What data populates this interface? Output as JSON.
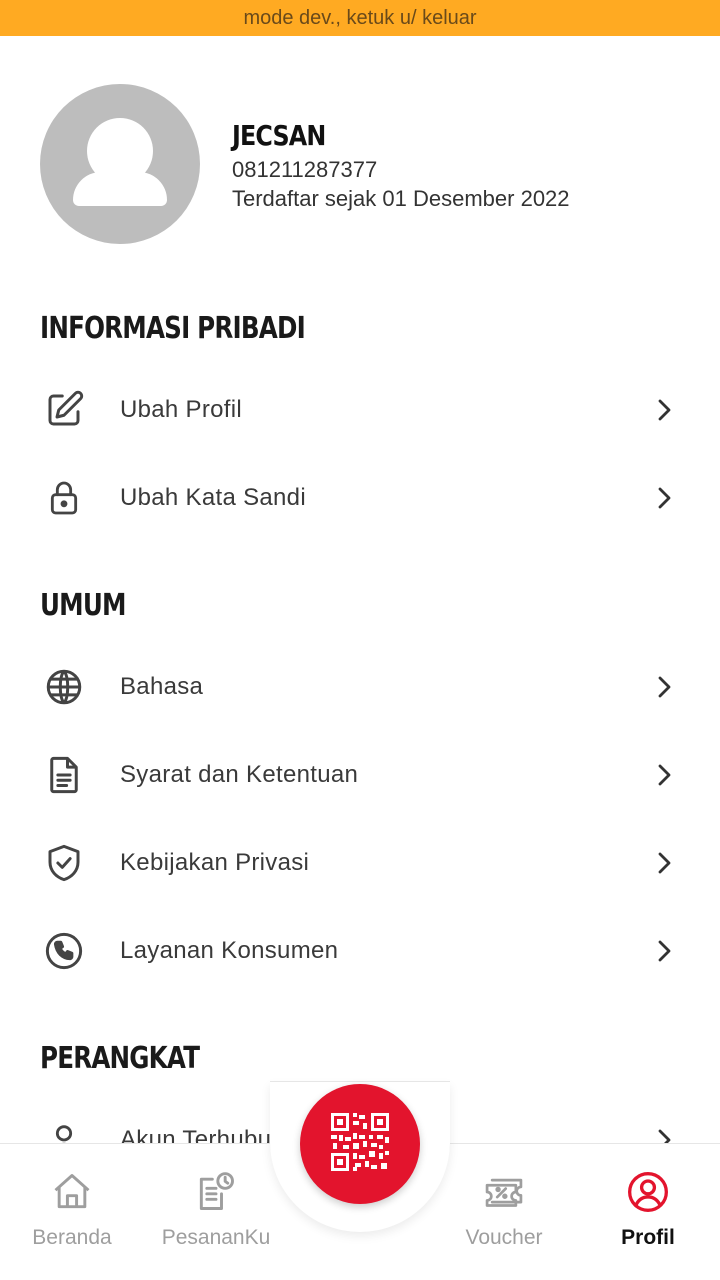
{
  "dev_banner": {
    "text": "mode dev., ketuk u/ keluar",
    "color": "#FFAA22"
  },
  "profile": {
    "name": "JECSAN",
    "phone": "081211287377",
    "registered": "Terdaftar sejak 01 Desember 2022",
    "avatar_icon": "user-silhouette-icon"
  },
  "sections": {
    "personal": {
      "title": "INFORMASI PRIBADI",
      "items": [
        {
          "label": "Ubah Profil",
          "icon": "edit-icon"
        },
        {
          "label": "Ubah Kata Sandi",
          "icon": "lock-icon"
        }
      ]
    },
    "general": {
      "title": "UMUM",
      "items": [
        {
          "label": "Bahasa",
          "icon": "globe-icon"
        },
        {
          "label": "Syarat dan Ketentuan",
          "icon": "document-icon"
        },
        {
          "label": "Kebijakan Privasi",
          "icon": "shield-check-icon"
        },
        {
          "label": "Layanan Konsumen",
          "icon": "phone-icon"
        }
      ]
    },
    "device": {
      "title": "PERANGKAT",
      "items": [
        {
          "label": "Akun Terhubung",
          "icon": "user-icon"
        }
      ]
    }
  },
  "bottom_nav": {
    "items": [
      {
        "label": "Beranda",
        "icon": "home-icon"
      },
      {
        "label": "PesananKu",
        "icon": "orders-clock-icon"
      },
      {
        "label": "Voucher",
        "icon": "voucher-icon"
      },
      {
        "label": "Profil",
        "icon": "profile-icon",
        "active": true
      }
    ],
    "qr_button_icon": "qr-code-icon",
    "accent": "#E3142D"
  }
}
